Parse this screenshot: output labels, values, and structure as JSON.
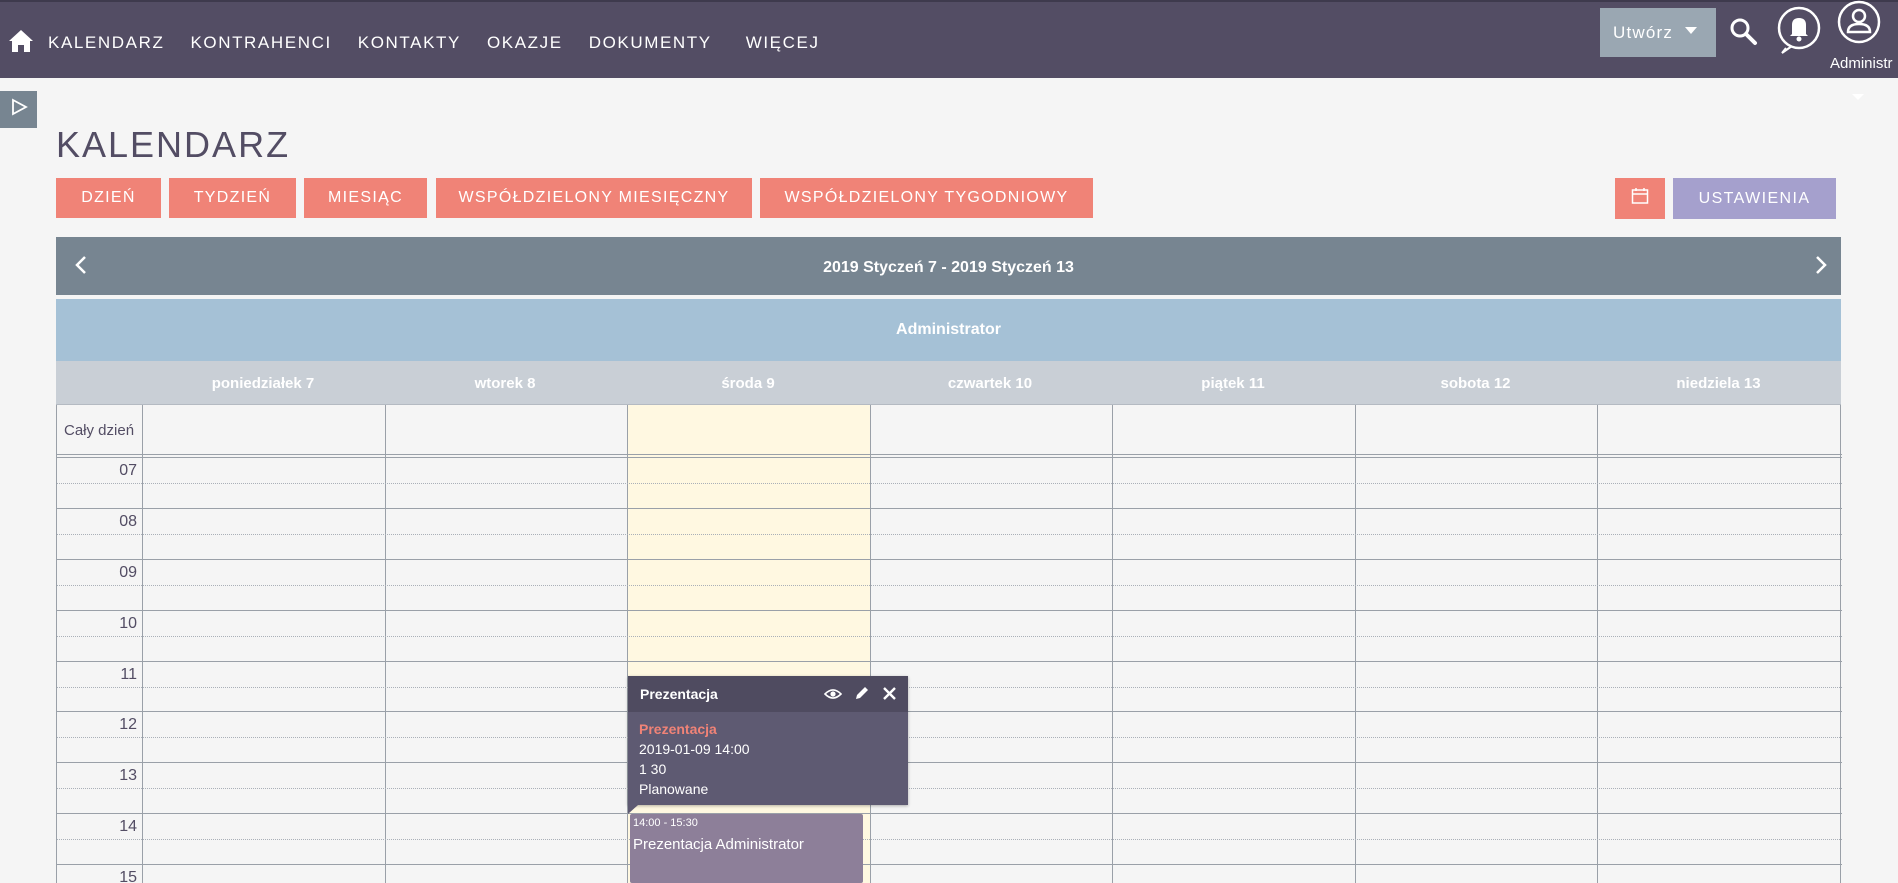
{
  "nav": {
    "items": [
      "KALENDARZ",
      "KONTRAHENCI",
      "KONTAKTY",
      "OKAZJE",
      "DOKUMENTY",
      "WIĘCEJ"
    ],
    "create_label": "Utwórz",
    "user_name": "Administr"
  },
  "page": {
    "title": "KALENDARZ"
  },
  "views": {
    "day": "DZIEŃ",
    "week": "TYDZIEŃ",
    "month": "MIESIĄC",
    "shared_month": "WSPÓŁDZIELONY MIESIĘCZNY",
    "shared_week": "WSPÓŁDZIELONY TYGODNIOWY",
    "settings": "USTAWIENIA"
  },
  "calendar": {
    "range": "2019 Styczeń 7 - 2019 Styczeń 13",
    "user": "Administrator",
    "days": [
      "poniedziałek 7",
      "wtorek 8",
      "środa 9",
      "czwartek 10",
      "piątek 11",
      "sobota 12",
      "niedziela 13"
    ],
    "all_day_label": "Cały dzień",
    "hours": [
      "07",
      "08",
      "09",
      "10",
      "11",
      "12",
      "13",
      "14",
      "15"
    ]
  },
  "event": {
    "time": "14:00 - 15:30",
    "title": "Prezentacja Administrator"
  },
  "popover": {
    "title": "Prezentacja",
    "link": "Prezentacja",
    "datetime": "2019-01-09 14:00",
    "duration": "1 30",
    "status": "Planowane"
  },
  "colors": {
    "topbar": "#534d64",
    "accent_coral": "#f08377",
    "settings_purple": "#a5a0cd",
    "nav_gray": "#778591",
    "user_band": "#a5c1d6",
    "today_col": "#fff8e1",
    "event": "#8d7f99"
  },
  "icons": [
    "home-icon",
    "search-icon",
    "bell-icon",
    "user-icon",
    "sidebar-toggle-icon",
    "calendar-icon",
    "chevron-left-icon",
    "chevron-right-icon",
    "eye-icon",
    "pencil-icon",
    "close-icon"
  ]
}
